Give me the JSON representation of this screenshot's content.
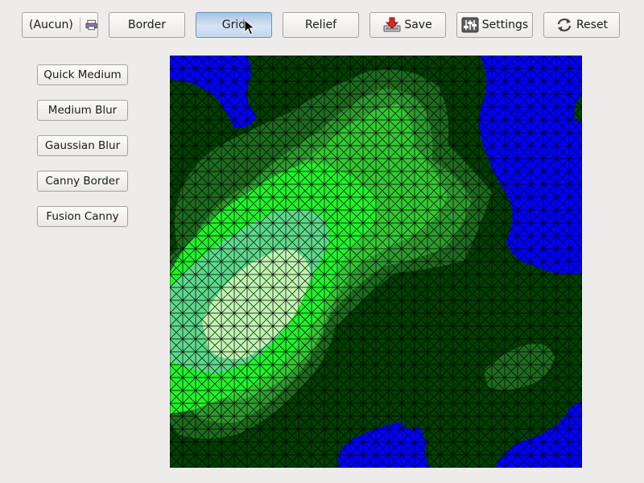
{
  "toolbar": {
    "combo": {
      "selected": "(Aucun)",
      "icon": "printer-icon"
    },
    "border_label": "Border",
    "grid_label": "Grid",
    "relief_label": "Relief",
    "save_label": "Save",
    "settings_label": "Settings",
    "reset_label": "Reset"
  },
  "filters": {
    "quick_medium_label": "Quick Medium",
    "medium_blur_label": "Medium Blur",
    "gaussian_blur_label": "Gaussian Blur",
    "canny_border_label": "Canny Border",
    "fusion_canny_label": "Fusion Canny"
  },
  "map": {
    "colors": {
      "water": "#0000ff",
      "lowland": "#003f00",
      "low_hills": "#1e6b1e",
      "hills": "#2f9a2f",
      "slopes": "#34c834",
      "high": "#22f22c",
      "peaks": "#5dd98a",
      "summit": "#bff5b0",
      "grid_lines": "#000000"
    },
    "grid_overlay": true
  }
}
